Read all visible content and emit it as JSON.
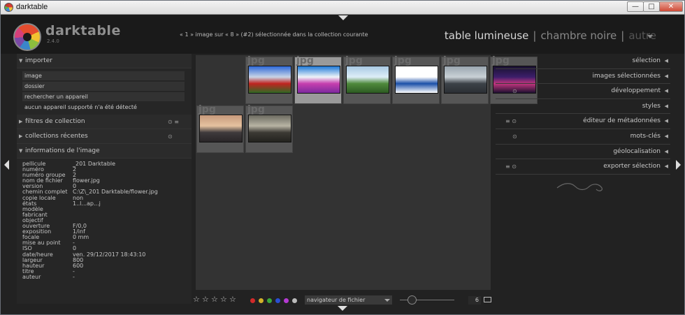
{
  "window": {
    "title": "darktable",
    "min": "—",
    "max": "□",
    "close": "✕"
  },
  "app": {
    "name": "darktable",
    "version": "2.4.0"
  },
  "status": "« 1 » image sur « 8 » (#2) sélectionnée dans la collection courante",
  "views": {
    "active": "table lumineuse",
    "sep": "|",
    "darkroom": "chambre noire",
    "other": "autre"
  },
  "left": {
    "import": {
      "title": "importer",
      "buttons": [
        "image",
        "dossier",
        "rechercher un appareil"
      ],
      "note": "aucun appareil supporté n'a été détecté"
    },
    "filters": {
      "title": "filtres de collection",
      "icons": "⊙ ≡"
    },
    "recent": {
      "title": "collections récentes",
      "icon": "⊙"
    },
    "info": {
      "title": "informations de l'image",
      "rows": [
        [
          "pellicule",
          "_201 Darktable"
        ],
        [
          "numéro",
          "2"
        ],
        [
          "numéro groupe",
          "2"
        ],
        [
          "nom de fichier",
          "flower.jpg"
        ],
        [
          "version",
          "0"
        ],
        [
          "chemin complet",
          "C:\\Z\\_201 Darktable/flower.jpg"
        ],
        [
          "copie locale",
          "non"
        ],
        [
          "états",
          "1..l...ap...j"
        ],
        [
          "modèle",
          ""
        ],
        [
          "fabricant",
          ""
        ],
        [
          "objectif",
          ""
        ],
        [
          "ouverture",
          "F/0,0"
        ],
        [
          "exposition",
          "1/inf"
        ],
        [
          "focale",
          "0 mm"
        ],
        [
          "mise au point",
          "-"
        ],
        [
          "ISO",
          "0"
        ],
        [
          "date/heure",
          "ven. 29/12/2017 18:43:10"
        ],
        [
          "largeur",
          "800"
        ],
        [
          "hauteur",
          "600"
        ],
        [
          "titre",
          "-"
        ],
        [
          "auteur",
          "-"
        ]
      ]
    }
  },
  "thumbs": [
    {
      "ext": "jpg",
      "colors": [
        "#2e6ad8",
        "#c8d4e6",
        "#c02420",
        "#2f6a25"
      ],
      "selected": false
    },
    {
      "ext": "jpg",
      "colors": [
        "#1f7ad8",
        "#eef3f8",
        "#c63fae",
        "#7c2a9e"
      ],
      "selected": true
    },
    {
      "ext": "jpg",
      "colors": [
        "#a9c9e3",
        "#ddeef7",
        "#4f8a3c",
        "#2c5a22"
      ],
      "selected": false
    },
    {
      "ext": "jpg",
      "colors": [
        "#ffffff",
        "#ffffff",
        "#1b4fa8",
        "#ffffff"
      ],
      "selected": false
    },
    {
      "ext": "jpg",
      "colors": [
        "#9aa6b0",
        "#c9d1d6",
        "#3c4248",
        "#2b2f34"
      ],
      "selected": false
    },
    {
      "ext": "jpg",
      "colors": [
        "#1a1230",
        "#3c1e6a",
        "#c2357e",
        "#1d1030"
      ],
      "selected": false
    },
    {
      "ext": "jpg",
      "colors": [
        "#c79a7c",
        "#e6c2a0",
        "#3e3a3c",
        "#2a2628"
      ],
      "selected": false
    },
    {
      "ext": "jpg",
      "colors": [
        "#6b6a60",
        "#b8b4a4",
        "#3c3a34",
        "#24231f"
      ],
      "selected": false
    }
  ],
  "bottom": {
    "stars": [
      "☆",
      "☆",
      "☆",
      "☆",
      "☆"
    ],
    "color_labels": [
      "#d22a2a",
      "#d2b22a",
      "#3aa83a",
      "#2a4fd2",
      "#b43ad2",
      "#bbbbbb"
    ],
    "nav_select": "navigateur de fichier",
    "per_row": "6"
  },
  "right": {
    "sections": [
      {
        "title": "sélection",
        "icons": ""
      },
      {
        "title": "images sélectionnées",
        "icons": ""
      },
      {
        "title": "développement",
        "icons": "⊙"
      },
      {
        "title": "styles",
        "icons": ""
      },
      {
        "title": "éditeur de métadonnées",
        "icons": "≡ ⊙"
      },
      {
        "title": "mots-clés",
        "icons": "⊙"
      },
      {
        "title": "géolocalisation",
        "icons": ""
      },
      {
        "title": "exporter sélection",
        "icons": "≡ ⊙"
      }
    ]
  }
}
